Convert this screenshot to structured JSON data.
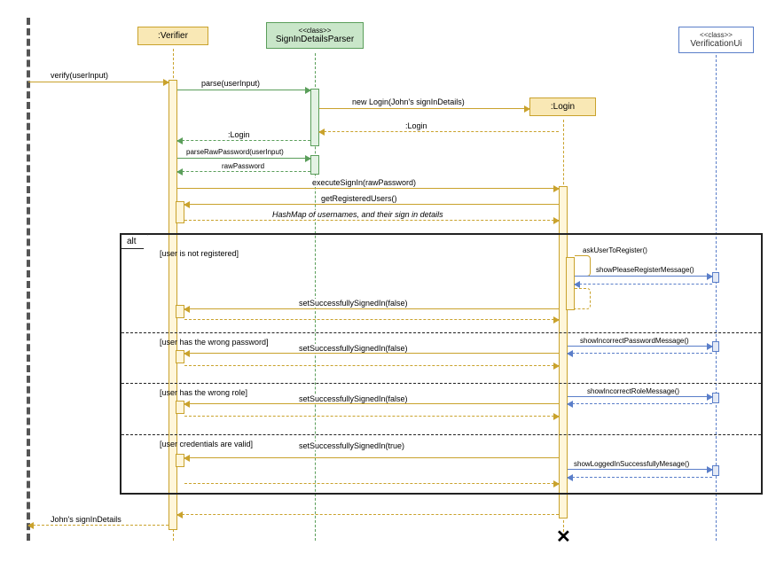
{
  "lifelines": {
    "actor": "",
    "verifier": ":Verifier",
    "parser_stereo": "<<class>>",
    "parser": "SignInDetailsParser",
    "login": ":Login",
    "ui_stereo": "<<class>>",
    "ui": "VerificationUi"
  },
  "messages": {
    "verify": "verify(userInput)",
    "parse": "parse(userInput)",
    "newLogin": "new Login(John's signInDetails)",
    "retLogin1": ":Login",
    "retLogin2": ":Login",
    "parseRaw": "parseRawPassword(userInput)",
    "rawPwd": "rawPassword",
    "execSignIn": "executeSignIn(rawPassword)",
    "getUsers": "getRegisteredUsers()",
    "hashmap": "HashMap of usernames, and their sign in details",
    "askRegister": "askUserToRegister()",
    "showRegister": "showPleaseRegisterMessage()",
    "setFalse": "setSuccessfullySignedIn(false)",
    "showIncorrectPwd": "showIncorrectPasswordMessage()",
    "showIncorrectRole": "showIncorrectRoleMessage()",
    "setTrue": "setSuccessfullySignedIn(true)",
    "showLogged": "showLoggedInSuccessfullyMesage()",
    "retSignIn": "John's signInDetails"
  },
  "alt": {
    "label": "alt",
    "g1": "[user is not registered]",
    "g2": "[user has the wrong password]",
    "g3": "[user has the wrong role]",
    "g4": "[user credentials are valid]"
  }
}
